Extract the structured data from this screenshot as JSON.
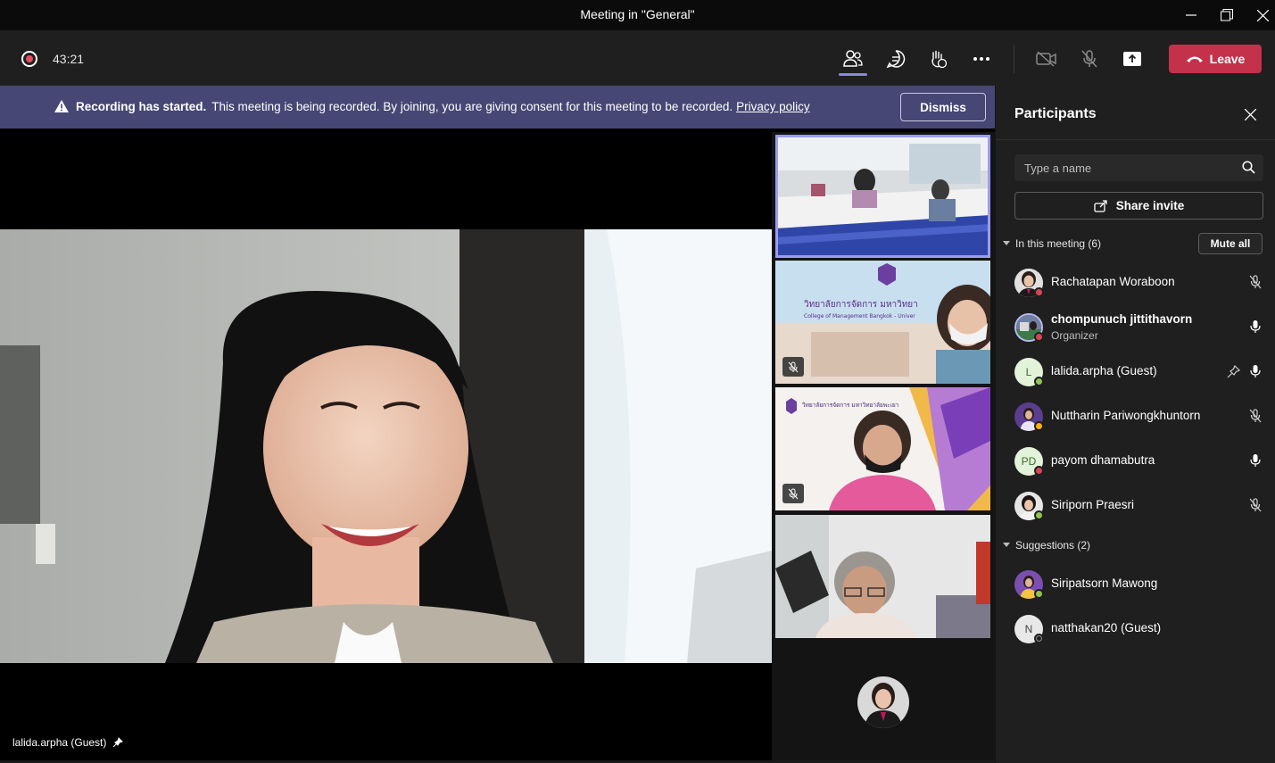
{
  "window": {
    "title": "Meeting in \"General\""
  },
  "toolbar": {
    "timer": "43:21",
    "leave_label": "Leave"
  },
  "banner": {
    "bold_text": "Recording has started.",
    "text": "This meeting is being recorded. By joining, you are giving consent for this meeting to be recorded.",
    "link_text": "Privacy policy",
    "dismiss_label": "Dismiss"
  },
  "stage": {
    "main_name": "lalida.arpha (Guest)"
  },
  "panel": {
    "title": "Participants",
    "search_placeholder": "Type a name",
    "share_label": "Share invite",
    "in_meeting_label": "In this meeting (6)",
    "mute_all_label": "Mute all",
    "suggestions_label": "Suggestions (2)",
    "participants": [
      {
        "name": "Rachatapan Woraboon",
        "role": "",
        "initials": "",
        "status": "busy",
        "mic": "muted"
      },
      {
        "name": "chompunuch jittithavorn",
        "role": "Organizer",
        "initials": "",
        "status": "busy",
        "mic": "on"
      },
      {
        "name": "lalida.arpha (Guest)",
        "role": "",
        "initials": "L",
        "status": "available",
        "mic": "on"
      },
      {
        "name": "Nuttharin Pariwongkhuntorn",
        "role": "",
        "initials": "",
        "status": "away",
        "mic": "muted"
      },
      {
        "name": "payom dhamabutra",
        "role": "",
        "initials": "PD",
        "status": "busy",
        "mic": "on"
      },
      {
        "name": "Siriporn Praesri",
        "role": "",
        "initials": "",
        "status": "available",
        "mic": "muted"
      }
    ],
    "suggestions": [
      {
        "name": "Siripatsorn Mawong",
        "initials": "",
        "status": "available"
      },
      {
        "name": "natthakan20 (Guest)",
        "initials": "N",
        "status": "offline"
      }
    ]
  },
  "colors": {
    "accent": "#8a8ad6",
    "leave": "#c4314b",
    "banner": "#464775",
    "busy": "#d74654",
    "available": "#92c353",
    "away": "#fcb20d"
  }
}
